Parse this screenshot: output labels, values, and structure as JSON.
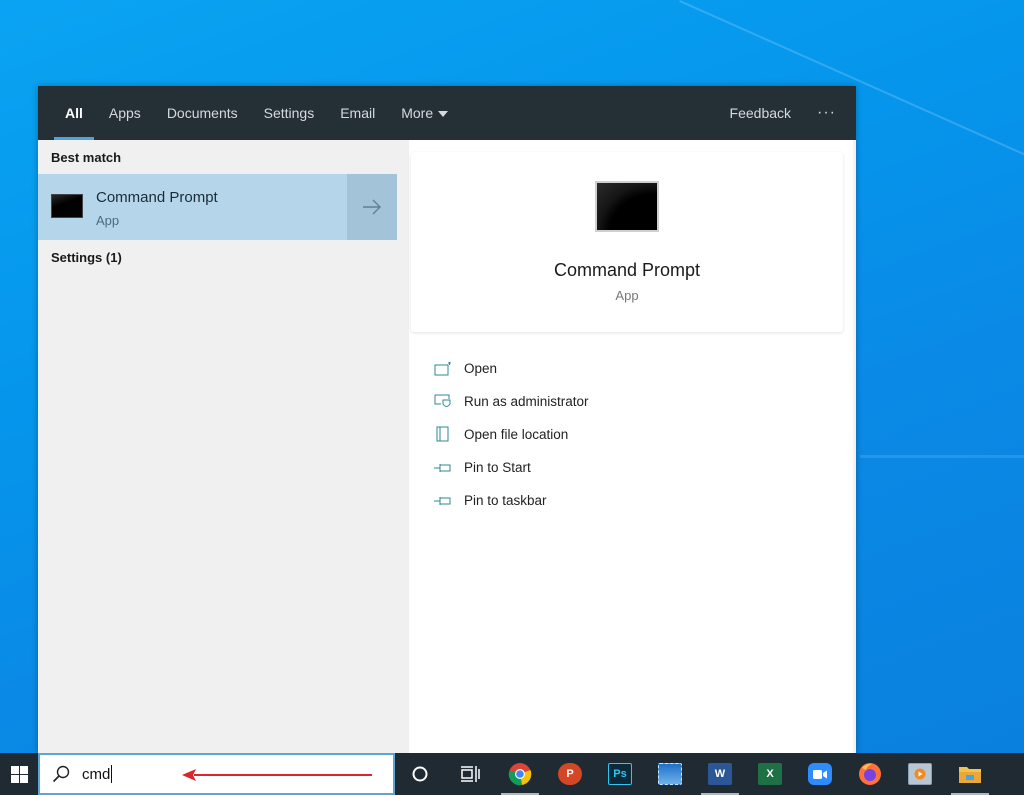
{
  "search_panel": {
    "tabs": [
      {
        "label": "All",
        "active": true
      },
      {
        "label": "Apps"
      },
      {
        "label": "Documents"
      },
      {
        "label": "Settings"
      },
      {
        "label": "Email"
      },
      {
        "label": "More"
      }
    ],
    "feedback_label": "Feedback",
    "more_options_label": "···",
    "best_match_heading": "Best match",
    "best_match": {
      "title": "Command Prompt",
      "subtitle": "App",
      "icon": "command-prompt-icon",
      "arrow_icon": "arrow-right-icon"
    },
    "settings_heading": "Settings (1)",
    "preview": {
      "title": "Command Prompt",
      "subtitle": "App",
      "icon": "command-prompt-icon"
    },
    "actions": [
      {
        "label": "Open",
        "icon": "open-window-icon"
      },
      {
        "label": "Run as administrator",
        "icon": "shield-window-icon"
      },
      {
        "label": "Open file location",
        "icon": "folder-location-icon"
      },
      {
        "label": "Pin to Start",
        "icon": "pin-icon"
      },
      {
        "label": "Pin to taskbar",
        "icon": "pin-icon"
      }
    ]
  },
  "taskbar": {
    "search_value": "cmd",
    "search_icon": "search-icon",
    "apps": [
      {
        "name": "cortana",
        "icon": "cortana-icon"
      },
      {
        "name": "task-view",
        "icon": "task-view-icon"
      },
      {
        "name": "chrome",
        "icon": "chrome-icon",
        "running": true
      },
      {
        "name": "powerpoint",
        "icon": "powerpoint-icon",
        "label": "P"
      },
      {
        "name": "photoshop",
        "icon": "photoshop-icon",
        "label": "Ps"
      },
      {
        "name": "photos",
        "icon": "photos-icon"
      },
      {
        "name": "word",
        "icon": "word-icon",
        "label": "W",
        "running": true
      },
      {
        "name": "excel",
        "icon": "excel-icon",
        "label": "X"
      },
      {
        "name": "zoom",
        "icon": "zoom-icon"
      },
      {
        "name": "firefox",
        "icon": "firefox-icon"
      },
      {
        "name": "media-player",
        "icon": "media-player-icon"
      },
      {
        "name": "file-explorer",
        "icon": "file-explorer-icon",
        "running": true
      }
    ]
  },
  "colors": {
    "nav_bg": "#252f36",
    "selected_bg": "#b5d6ea",
    "accent": "#4fa3d9",
    "annotation_arrow": "#d9262b"
  }
}
